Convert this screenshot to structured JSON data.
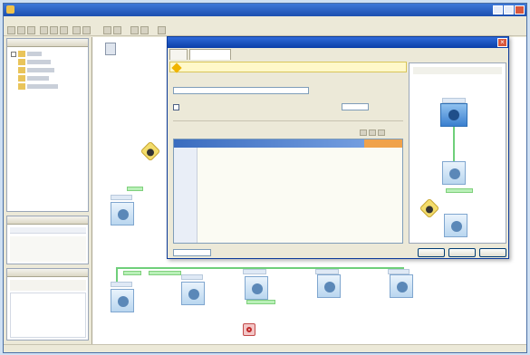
{
  "window": {
    "title": ""
  },
  "menu": {
    "items": [
      "",
      "",
      "",
      "",
      "",
      "",
      ""
    ]
  },
  "dialog": {
    "title": "",
    "tabs": [
      "",
      ""
    ],
    "warning": "",
    "buttons": {
      "back": "",
      "finish": "",
      "cancel": ""
    }
  },
  "colors": {
    "accent": "#1c4fb0",
    "node": "#b9d6ef",
    "link": "#6fcf7a",
    "warning": "#f3dc6b"
  },
  "icons": [
    "app-icon",
    "component-icon",
    "warning-icon",
    "error-icon",
    "close-icon"
  ]
}
